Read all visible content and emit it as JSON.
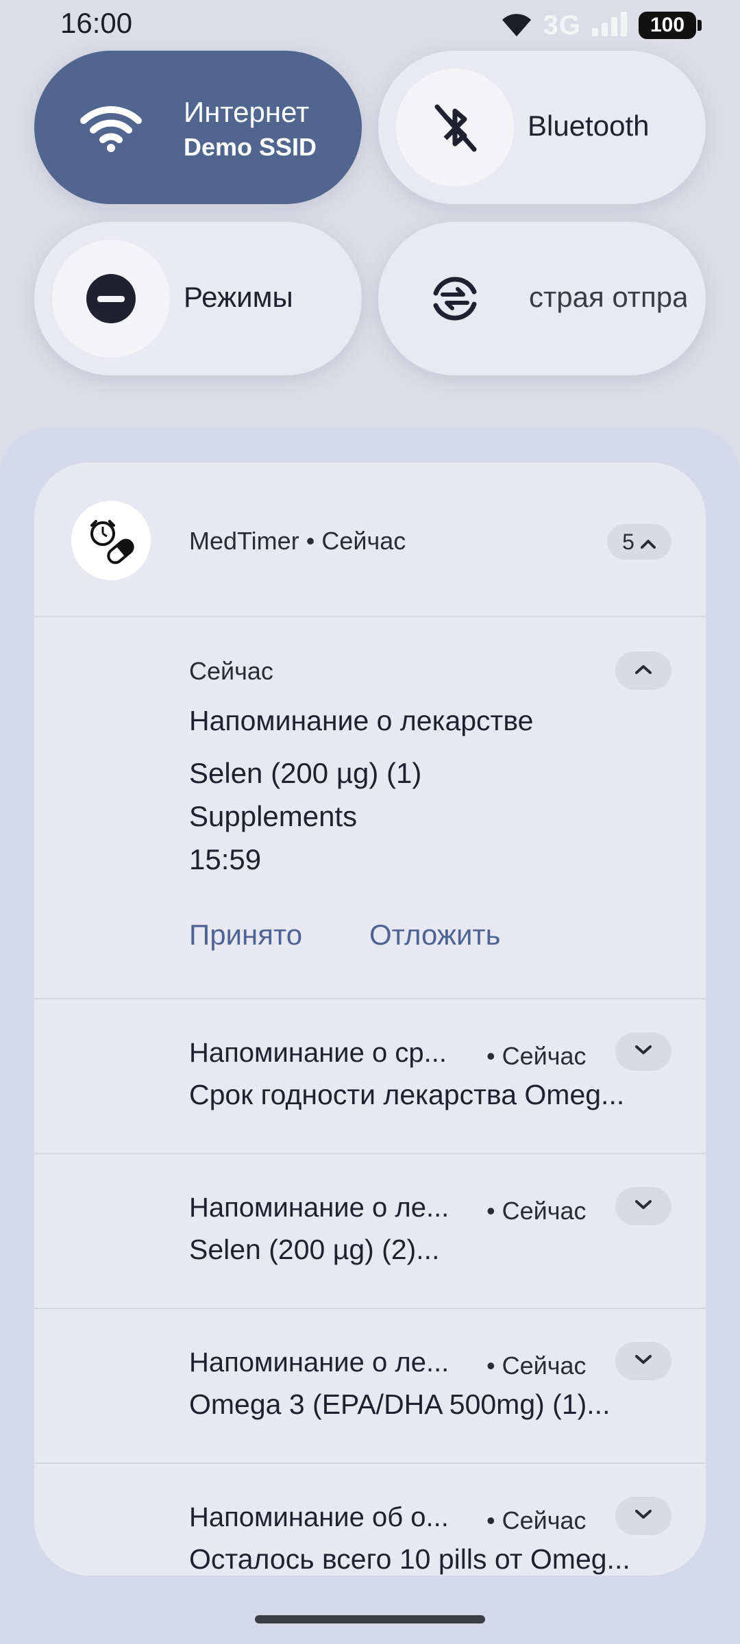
{
  "status_bar": {
    "time": "16:00",
    "network": "3G",
    "battery": "100",
    "icons": [
      "wifi-icon",
      "signal-icon",
      "battery-icon"
    ]
  },
  "quick_settings": {
    "tiles": [
      {
        "title": "Интернет",
        "subtitle": "Demo SSID",
        "icon": "wifi-icon",
        "active": true
      },
      {
        "title": "Bluetooth",
        "icon": "bluetooth-off-icon",
        "active": false
      },
      {
        "title": "Режимы",
        "icon": "do-not-disturb-icon",
        "active": false
      },
      {
        "title": "страя отпра",
        "icon": "quick-share-icon",
        "active": false
      }
    ]
  },
  "notification": {
    "app_name": "MedTimer",
    "header_time": "Сейчас",
    "header_separator": "•",
    "count": "5",
    "expanded": {
      "time": "Сейчас",
      "title": "Напоминание о лекарстве",
      "lines": [
        "Selen (200 µg) (1)",
        "Supplements",
        "15:59"
      ],
      "actions": [
        "Принято",
        "Отложить"
      ]
    },
    "items": [
      {
        "title": "Напоминание о ср...",
        "time": "• Сейчас",
        "body": "Срок годности лекарства Omeg..."
      },
      {
        "title": "Напоминание о ле...",
        "time": "• Сейчас",
        "body": "Selen (200 µg) (2)..."
      },
      {
        "title": "Напоминание о ле...",
        "time": "• Сейчас",
        "body": "Omega 3 (EPA/DHA 500mg) (1)..."
      },
      {
        "title": "Напоминание об о...",
        "time": "• Сейчас",
        "body": "Осталось всего 10 pills от Omeg..."
      }
    ]
  },
  "colors": {
    "accent": "#51668f",
    "action_text": "#4d6492",
    "background": "#dcdde8"
  }
}
